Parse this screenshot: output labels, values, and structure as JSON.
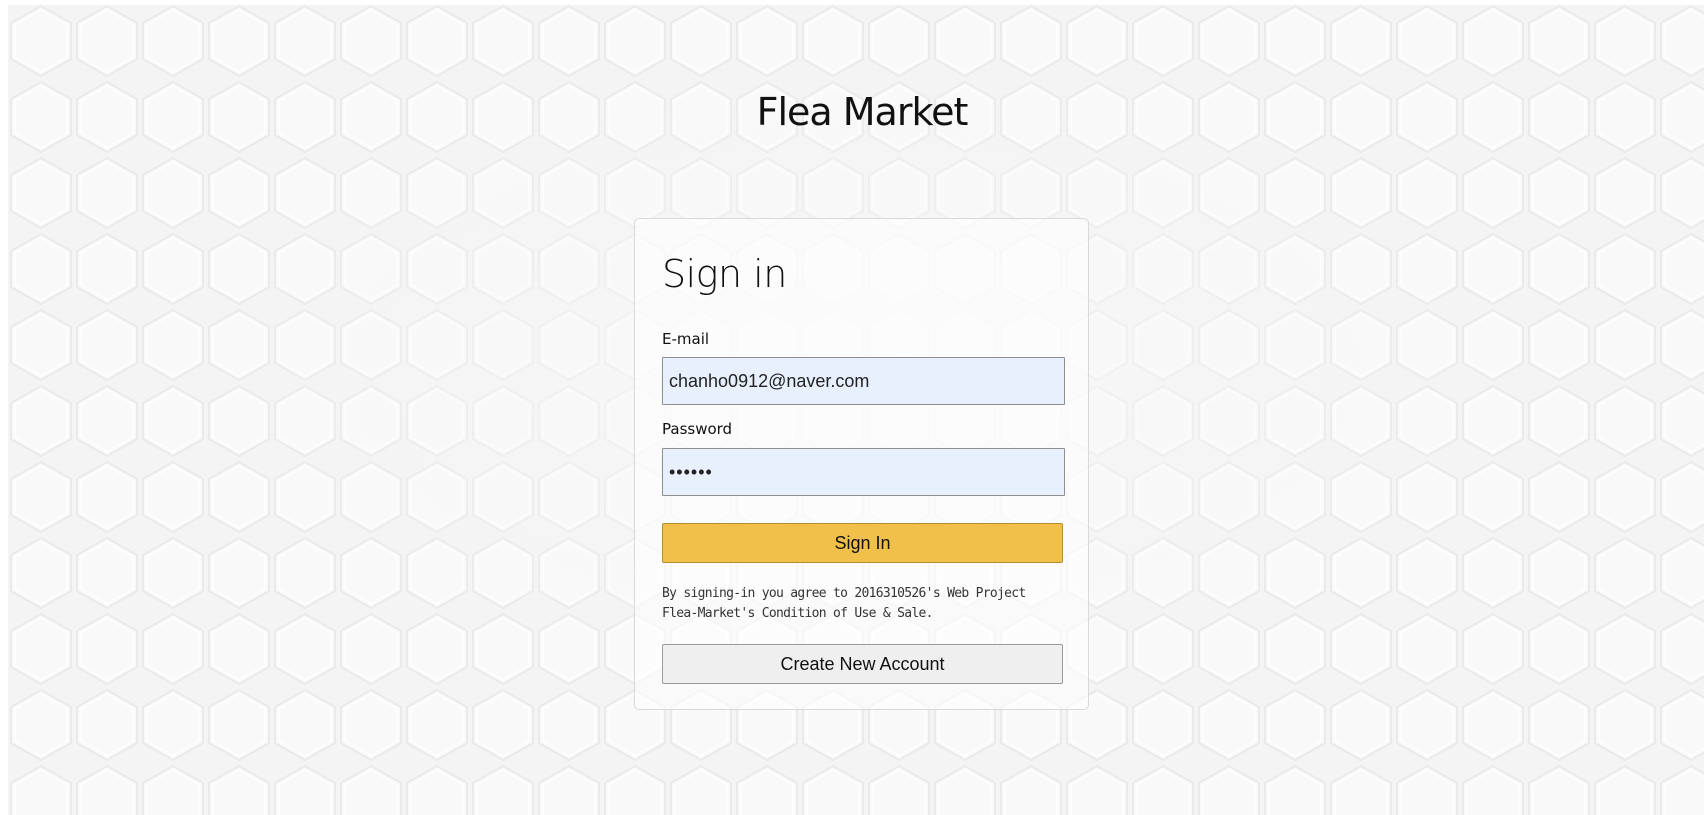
{
  "brand": {
    "title": "Flea Market"
  },
  "signin_card": {
    "heading": "Sign in",
    "email": {
      "label": "E-mail",
      "value": "chanho0912@naver.com"
    },
    "password": {
      "label": "Password",
      "value": "••••••"
    },
    "signin_button_label": "Sign In",
    "terms_text": "By signing-in you agree to 2016310526's Web Project Flea-Market's Condition of Use & Sale.",
    "create_account_button_label": "Create New Account"
  },
  "colors": {
    "page_background": "#f6f6f6",
    "input_background": "#e8f0fe",
    "signin_button": "#f0c04b",
    "create_button": "#efefef"
  },
  "icons": [
    "hexagon-pattern-background"
  ]
}
